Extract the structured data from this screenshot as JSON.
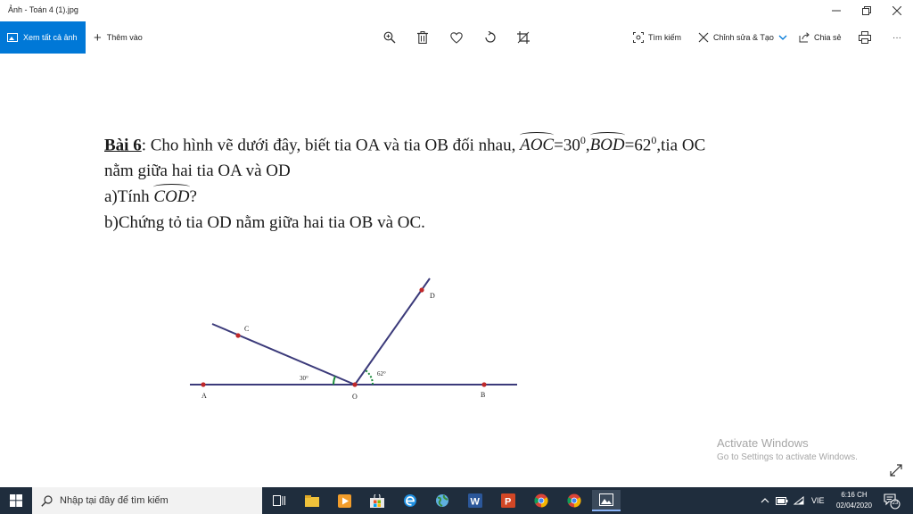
{
  "window": {
    "title": "Ảnh - Toán 4 (1).jpg"
  },
  "toolbar": {
    "view_all": "Xem tất cả ảnh",
    "add_to": "Thêm vào",
    "search": "Tìm kiếm",
    "edit_create": "Chỉnh sửa & Tạo",
    "share": "Chia sẻ",
    "more": "···"
  },
  "problem": {
    "label": "Bài 6",
    "line1_a": ": Cho hình vẽ dưới đây, biết tia OA và tia OB đối nhau, ",
    "angle_aoc": "AOC",
    "aoc_val": "=30",
    "deg": "0",
    "sep": ",",
    "angle_bod": "BOD",
    "bod_val": "=62",
    "line1_b": ",tia OC",
    "line2": "nằm giữa hai tia OA và OD",
    "q_a_prefix": "a)Tính ",
    "angle_cod": "COD",
    "q_a_suffix": "?",
    "q_b": "b)Chứng tỏ tia OD nằm giữa hai tia OB và OC."
  },
  "figure": {
    "labels": {
      "A": "A",
      "O": "O",
      "B": "B",
      "C": "C",
      "D": "D",
      "angle_30": "30°",
      "angle_62": "62°"
    },
    "line_color": "#3b3a7a",
    "point_color": "#c0282a",
    "arc_color": "#1a8a3a"
  },
  "watermark": {
    "title": "Activate Windows",
    "subtitle": "Go to Settings to activate Windows."
  },
  "taskbar": {
    "search_placeholder": "Nhập tại đây để tìm kiếm",
    "language": "VIE",
    "time": "6:16 CH",
    "date": "02/04/2020",
    "notifications": "23"
  }
}
